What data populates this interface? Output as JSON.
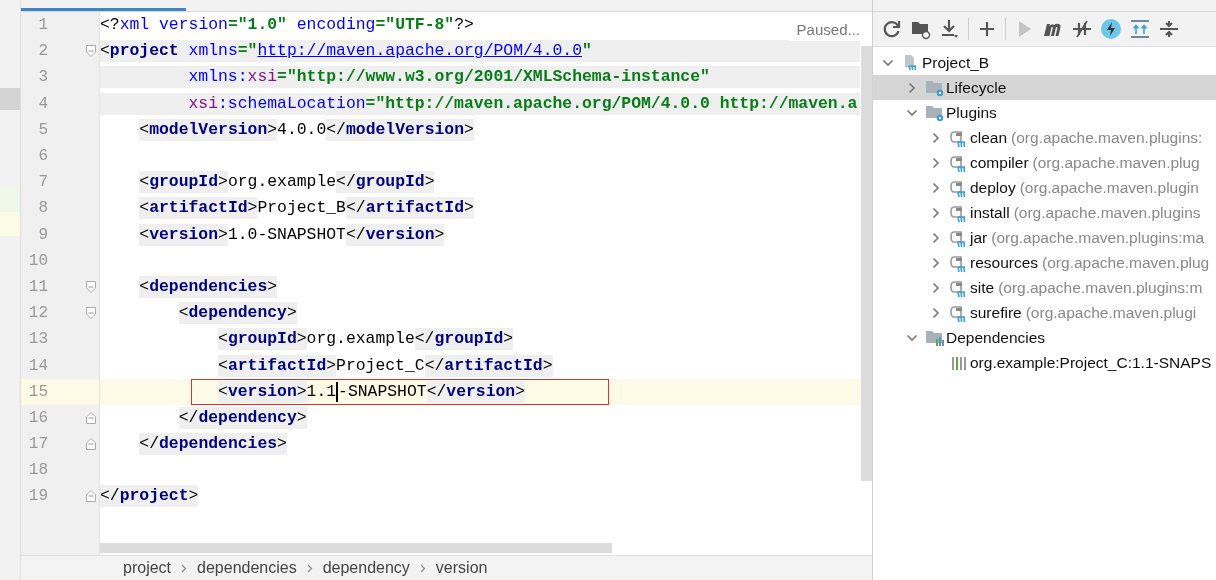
{
  "editor": {
    "status": "Paused...",
    "lines": [
      {
        "number": "1",
        "fold_start": false,
        "fold_end": false,
        "current": false,
        "shaded": false,
        "boxed": false,
        "tokens": [
          {
            "kind": "pi",
            "text": "<?"
          },
          {
            "kind": "attr",
            "text": "xml version"
          },
          {
            "kind": "val",
            "text": "=\"1.0\""
          },
          {
            "kind": "attr",
            "text": " encoding"
          },
          {
            "kind": "val",
            "text": "=\"UTF-8\""
          },
          {
            "kind": "pi",
            "text": "?>"
          }
        ]
      },
      {
        "number": "2",
        "fold_start": true,
        "fold_end": false,
        "current": false,
        "shaded": true,
        "boxed": false,
        "tokens": [
          {
            "kind": "p",
            "text": "<"
          },
          {
            "kind": "tag",
            "text": "project"
          },
          {
            "kind": "attr",
            "text": " xmlns"
          },
          {
            "kind": "val",
            "text": "=\""
          },
          {
            "kind": "url",
            "text": "http://maven.apache.org/POM/4.0.0"
          },
          {
            "kind": "val",
            "text": "\""
          }
        ]
      },
      {
        "number": "3",
        "fold_start": false,
        "fold_end": false,
        "current": false,
        "shaded": true,
        "boxed": false,
        "tokens": [
          {
            "kind": "continuation"
          },
          {
            "kind": "attr",
            "text": "xmlns:"
          },
          {
            "kind": "ns",
            "text": "xsi"
          },
          {
            "kind": "val",
            "text": "=\"http://www.w3.org/2001/XMLSchema-instance\""
          }
        ]
      },
      {
        "number": "4",
        "fold_start": false,
        "fold_end": false,
        "current": false,
        "shaded": true,
        "boxed": false,
        "tokens": [
          {
            "kind": "continuation"
          },
          {
            "kind": "ns",
            "text": "xsi"
          },
          {
            "kind": "attr",
            "text": ":schemaLocation"
          },
          {
            "kind": "val",
            "text": "=\"http://maven.apache.org/POM/4.0.0 http://maven.a"
          }
        ]
      },
      {
        "number": "5",
        "fold_start": false,
        "fold_end": false,
        "current": false,
        "shaded": false,
        "boxed": false,
        "tokens": [
          {
            "kind": "indent"
          },
          {
            "kind": "p",
            "text": "<"
          },
          {
            "kind": "tag",
            "text": "modelVersion"
          },
          {
            "kind": "p",
            "text": ">"
          },
          {
            "kind": "txt",
            "text": "4.0.0"
          },
          {
            "kind": "p",
            "text": "</"
          },
          {
            "kind": "tag",
            "text": "modelVersion"
          },
          {
            "kind": "p",
            "text": ">"
          }
        ]
      },
      {
        "number": "6",
        "fold_start": false,
        "fold_end": false,
        "current": false,
        "shaded": false,
        "boxed": false
      },
      {
        "number": "7",
        "fold_start": false,
        "fold_end": false,
        "current": false,
        "shaded": false,
        "boxed": false,
        "tokens": [
          {
            "kind": "indent"
          },
          {
            "kind": "p",
            "text": "<"
          },
          {
            "kind": "tag",
            "text": "groupId"
          },
          {
            "kind": "p",
            "text": ">"
          },
          {
            "kind": "txt",
            "text": "org.example"
          },
          {
            "kind": "p",
            "text": "</"
          },
          {
            "kind": "tag",
            "text": "groupId"
          },
          {
            "kind": "p",
            "text": ">"
          }
        ]
      },
      {
        "number": "8",
        "fold_start": false,
        "fold_end": false,
        "current": false,
        "shaded": false,
        "boxed": false,
        "tokens": [
          {
            "kind": "indent"
          },
          {
            "kind": "p",
            "text": "<"
          },
          {
            "kind": "tag",
            "text": "artifactId"
          },
          {
            "kind": "p",
            "text": ">"
          },
          {
            "kind": "txt",
            "text": "Project_B"
          },
          {
            "kind": "p",
            "text": "</"
          },
          {
            "kind": "tag",
            "text": "artifactId"
          },
          {
            "kind": "p",
            "text": ">"
          }
        ]
      },
      {
        "number": "9",
        "fold_start": false,
        "fold_end": false,
        "current": false,
        "shaded": false,
        "boxed": false,
        "tokens": [
          {
            "kind": "indent"
          },
          {
            "kind": "p",
            "text": "<"
          },
          {
            "kind": "tag",
            "text": "version"
          },
          {
            "kind": "p",
            "text": ">"
          },
          {
            "kind": "txt",
            "text": "1.0-SNAPSHOT"
          },
          {
            "kind": "p",
            "text": "</"
          },
          {
            "kind": "tag",
            "text": "version"
          },
          {
            "kind": "p",
            "text": ">"
          }
        ]
      },
      {
        "number": "10",
        "fold_start": false,
        "fold_end": false,
        "current": false,
        "shaded": false,
        "boxed": false
      },
      {
        "number": "11",
        "fold_start": true,
        "fold_end": false,
        "current": false,
        "shaded": false,
        "boxed": false,
        "tokens": [
          {
            "kind": "indent"
          },
          {
            "kind": "p",
            "text": "<"
          },
          {
            "kind": "tag",
            "text": "dependencies"
          },
          {
            "kind": "p",
            "text": ">"
          }
        ]
      },
      {
        "number": "12",
        "fold_start": true,
        "fold_end": false,
        "current": false,
        "shaded": false,
        "boxed": false,
        "tokens": [
          {
            "kind": "indent"
          },
          {
            "kind": "indent"
          },
          {
            "kind": "p",
            "text": "<"
          },
          {
            "kind": "tag",
            "text": "dependency"
          },
          {
            "kind": "p",
            "text": ">"
          }
        ]
      },
      {
        "number": "13",
        "fold_start": false,
        "fold_end": false,
        "current": false,
        "shaded": false,
        "boxed": false,
        "tokens": [
          {
            "kind": "indent"
          },
          {
            "kind": "indent"
          },
          {
            "kind": "indent"
          },
          {
            "kind": "p",
            "text": "<"
          },
          {
            "kind": "tag",
            "text": "groupId"
          },
          {
            "kind": "p",
            "text": ">"
          },
          {
            "kind": "txt",
            "text": "org.example"
          },
          {
            "kind": "p",
            "text": "</"
          },
          {
            "kind": "tag",
            "text": "groupId"
          },
          {
            "kind": "p",
            "text": ">"
          }
        ]
      },
      {
        "number": "14",
        "fold_start": false,
        "fold_end": false,
        "current": false,
        "shaded": false,
        "boxed": false,
        "tokens": [
          {
            "kind": "indent"
          },
          {
            "kind": "indent"
          },
          {
            "kind": "indent"
          },
          {
            "kind": "p",
            "text": "<"
          },
          {
            "kind": "tag",
            "text": "artifactId"
          },
          {
            "kind": "p",
            "text": ">"
          },
          {
            "kind": "txt",
            "text": "Project_C"
          },
          {
            "kind": "p",
            "text": "</"
          },
          {
            "kind": "tag",
            "text": "artifactId"
          },
          {
            "kind": "p",
            "text": ">"
          }
        ]
      },
      {
        "number": "15",
        "fold_start": false,
        "fold_end": false,
        "current": true,
        "shaded": false,
        "boxed": true,
        "tokens": [
          {
            "kind": "indent"
          },
          {
            "kind": "indent"
          },
          {
            "kind": "indent"
          },
          {
            "kind": "p",
            "text": "<"
          },
          {
            "kind": "tag",
            "text": "version"
          },
          {
            "kind": "p",
            "text": ">"
          },
          {
            "kind": "txt",
            "text": "1.1"
          },
          {
            "kind": "caret"
          },
          {
            "kind": "txt",
            "text": "-SNAPSHOT"
          },
          {
            "kind": "p",
            "text": "</"
          },
          {
            "kind": "tag",
            "text": "version"
          },
          {
            "kind": "p",
            "text": ">"
          }
        ]
      },
      {
        "number": "16",
        "fold_start": false,
        "fold_end": true,
        "current": false,
        "shaded": false,
        "boxed": false,
        "tokens": [
          {
            "kind": "indent"
          },
          {
            "kind": "indent"
          },
          {
            "kind": "p",
            "text": "</"
          },
          {
            "kind": "tag",
            "text": "dependency"
          },
          {
            "kind": "p",
            "text": ">"
          }
        ]
      },
      {
        "number": "17",
        "fold_start": false,
        "fold_end": true,
        "current": false,
        "shaded": false,
        "boxed": false,
        "tokens": [
          {
            "kind": "indent"
          },
          {
            "kind": "p",
            "text": "</"
          },
          {
            "kind": "tag",
            "text": "dependencies"
          },
          {
            "kind": "p",
            "text": ">"
          }
        ]
      },
      {
        "number": "18",
        "fold_start": false,
        "fold_end": false,
        "current": false,
        "shaded": false,
        "boxed": false
      },
      {
        "number": "19",
        "fold_start": false,
        "fold_end": true,
        "current": false,
        "shaded": false,
        "boxed": false,
        "tokens": [
          {
            "kind": "p",
            "text": "</"
          },
          {
            "kind": "tag",
            "text": "project"
          },
          {
            "kind": "p",
            "text": ">"
          }
        ]
      }
    ]
  },
  "breadcrumb": [
    "project",
    "dependencies",
    "dependency",
    "version"
  ],
  "maven": {
    "toolbar": [
      {
        "kind": "refresh",
        "disabled": false,
        "on": false
      },
      {
        "kind": "folder-refresh",
        "disabled": false,
        "on": false
      },
      {
        "kind": "download",
        "disabled": false,
        "on": false
      },
      {
        "kind": "separator"
      },
      {
        "kind": "plus",
        "disabled": false,
        "on": false
      },
      {
        "kind": "separator"
      },
      {
        "kind": "run",
        "disabled": true,
        "on": false
      },
      {
        "kind": "m",
        "disabled": false,
        "on": false
      },
      {
        "kind": "skip",
        "disabled": false,
        "on": false
      },
      {
        "kind": "bolt",
        "disabled": false,
        "on": true
      },
      {
        "kind": "expand",
        "disabled": false,
        "on": false
      },
      {
        "kind": "collapse",
        "disabled": false,
        "on": false
      }
    ],
    "tree": [
      {
        "label": "Project_B",
        "kind": "project",
        "expanded": true,
        "selected": false,
        "children": [
          {
            "label": "Lifecycle",
            "kind": "folder",
            "expanded": false,
            "selected": true
          },
          {
            "label": "Plugins",
            "kind": "folder",
            "expanded": true,
            "selected": false,
            "children": [
              {
                "label": "clean",
                "detail": "(org.apache.maven.plugins:",
                "kind": "plugin",
                "expanded": false,
                "selected": false
              },
              {
                "label": "compiler",
                "detail": "(org.apache.maven.plug",
                "kind": "plugin",
                "expanded": false,
                "selected": false
              },
              {
                "label": "deploy",
                "detail": "(org.apache.maven.plugin",
                "kind": "plugin",
                "expanded": false,
                "selected": false
              },
              {
                "label": "install",
                "detail": "(org.apache.maven.plugins",
                "kind": "plugin",
                "expanded": false,
                "selected": false
              },
              {
                "label": "jar",
                "detail": "(org.apache.maven.plugins:ma",
                "kind": "plugin",
                "expanded": false,
                "selected": false
              },
              {
                "label": "resources",
                "detail": "(org.apache.maven.plug",
                "kind": "plugin",
                "expanded": false,
                "selected": false
              },
              {
                "label": "site",
                "detail": "(org.apache.maven.plugins:m",
                "kind": "plugin",
                "expanded": false,
                "selected": false
              },
              {
                "label": "surefire",
                "detail": "(org.apache.maven.plugi",
                "kind": "plugin",
                "expanded": false,
                "selected": false
              }
            ]
          },
          {
            "label": "Dependencies",
            "kind": "deps",
            "expanded": true,
            "selected": false,
            "children": [
              {
                "label": "org.example:Project_C:1.1-SNAPS",
                "kind": "lib",
                "selected": false
              }
            ]
          }
        ]
      }
    ]
  }
}
